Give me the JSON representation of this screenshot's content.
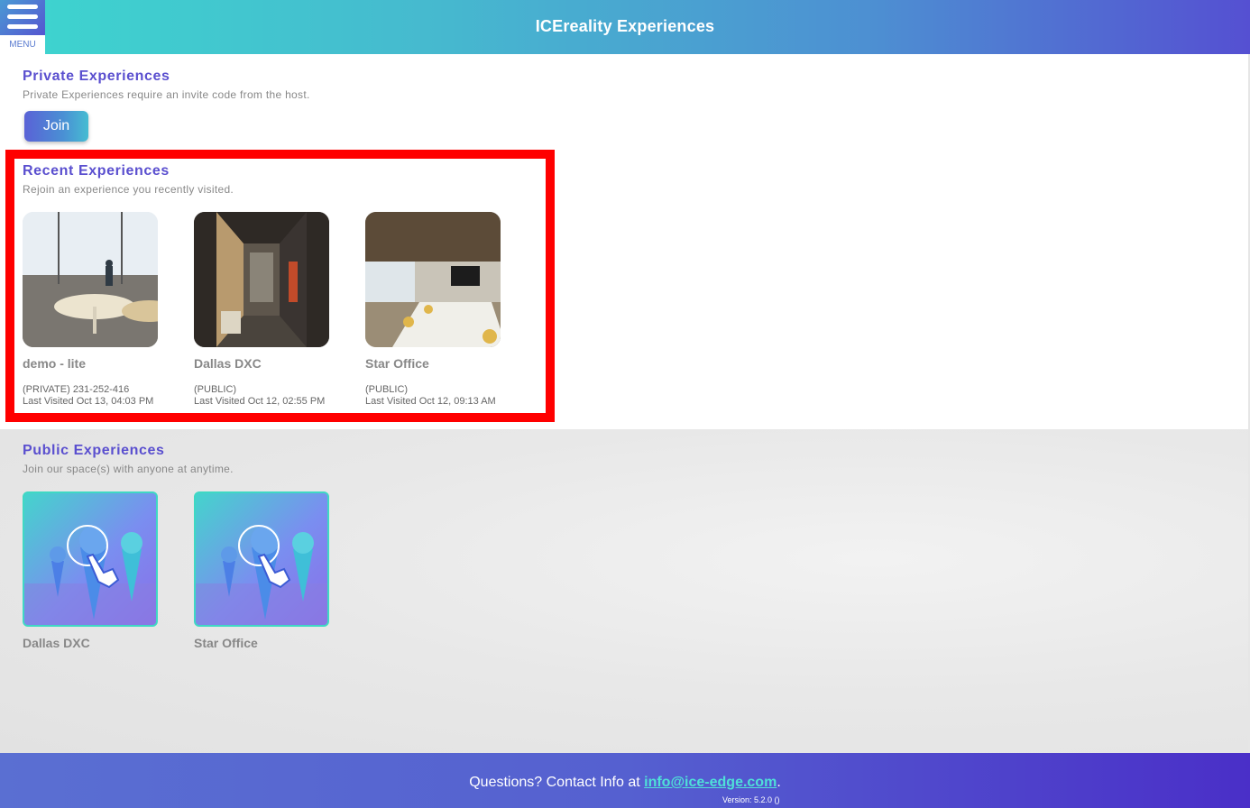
{
  "header": {
    "title": "ICEreality Experiences",
    "menu_label": "MENU"
  },
  "private": {
    "title": "Private Experiences",
    "subtitle": "Private Experiences require an invite code from the host.",
    "join_label": "Join"
  },
  "recent": {
    "title": "Recent Experiences",
    "subtitle": "Rejoin an experience you recently visited.",
    "items": [
      {
        "name": "demo - lite",
        "access": "(PRIVATE) 231-252-416",
        "visited": "Last Visited Oct 13, 04:03 PM"
      },
      {
        "name": "Dallas DXC",
        "access": "(PUBLIC)",
        "visited": "Last Visited Oct 12, 02:55 PM"
      },
      {
        "name": "Star Office",
        "access": "(PUBLIC)",
        "visited": "Last Visited Oct 12, 09:13 AM"
      }
    ]
  },
  "public": {
    "title": "Public Experiences",
    "subtitle": "Join our space(s) with anyone at anytime.",
    "items": [
      {
        "name": "Dallas DXC"
      },
      {
        "name": "Star Office"
      }
    ]
  },
  "footer": {
    "text": "Questions? Contact Info at ",
    "email": "info@ice-edge.com",
    "suffix": ".",
    "version": "Version: 5.2.0 ()"
  },
  "colors": {
    "accent": "#5a4fcf",
    "highlight": "#ff0000",
    "link": "#4fe0d8"
  }
}
